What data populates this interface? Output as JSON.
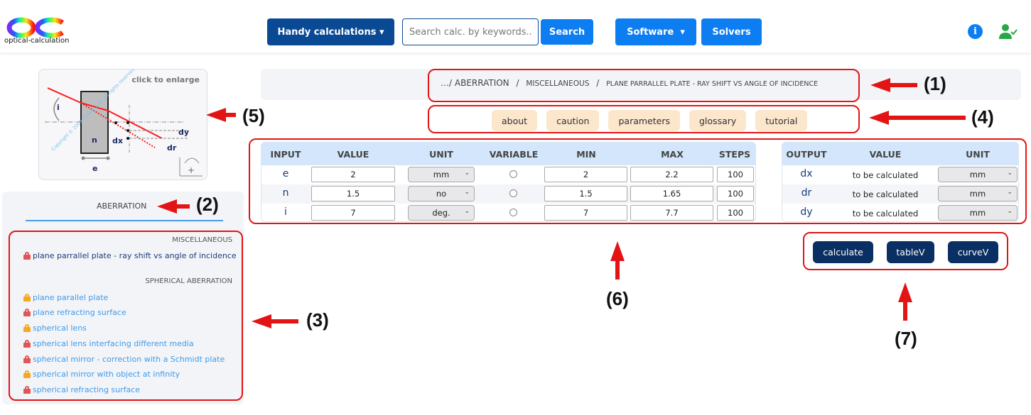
{
  "navbar": {
    "logo_text": "optical-calculation",
    "handy_label": "Handy calculations ▾",
    "search_placeholder": "Search calc. by keywords...",
    "search_label": "Search",
    "software_label": "Software  ▾",
    "solvers_label": "Solvers",
    "info_glyph": "i"
  },
  "thumbnail": {
    "label": "click to enlarge",
    "diagram": {
      "angle_label": "i",
      "index_label": "n",
      "thickness_label": "e",
      "dx_label": "dx",
      "dy_label": "dy",
      "dr_label": "dr",
      "watermark": "Copyright © 2009 CLAVIS SAS. All rights reserved"
    }
  },
  "sidebar": {
    "title": "ABERRATION",
    "categories": [
      {
        "name": "MISCELLANEOUS",
        "items": [
          {
            "label": "plane parrallel plate - ray shift vs angle of incidence",
            "lock": "red",
            "active": true
          }
        ]
      },
      {
        "name": "SPHERICAL ABERRATION",
        "items": [
          {
            "label": "plane parallel plate",
            "lock": "orange"
          },
          {
            "label": "plane refracting surface",
            "lock": "red"
          },
          {
            "label": "spherical lens",
            "lock": "orange"
          },
          {
            "label": "spherical lens interfacing different media",
            "lock": "red"
          },
          {
            "label": "spherical mirror - correction with a Schmidt plate",
            "lock": "red"
          },
          {
            "label": "spherical mirror with object at infinity",
            "lock": "orange"
          },
          {
            "label": "spherical refracting surface",
            "lock": "red"
          }
        ]
      }
    ]
  },
  "breadcrumb": {
    "prefix": "…/",
    "level1": "ABERRATION",
    "level2": "MISCELLANEOUS",
    "level3": "PLANE PARRALLEL PLATE - RAY SHIFT VS ANGLE OF INCIDENCE",
    "separator": "/"
  },
  "tabs": [
    "about",
    "caution",
    "parameters",
    "glossary",
    "tutorial"
  ],
  "input_table": {
    "headers": [
      "INPUT",
      "VALUE",
      "UNIT",
      "VARIABLE",
      "MIN",
      "MAX",
      "STEPS"
    ],
    "rows": [
      {
        "name": "e",
        "value": "2",
        "unit": "mm",
        "variable": false,
        "min": "2",
        "max": "2.2",
        "steps": "100"
      },
      {
        "name": "n",
        "value": "1.5",
        "unit": "no",
        "variable": false,
        "min": "1.5",
        "max": "1.65",
        "steps": "100"
      },
      {
        "name": "i",
        "value": "7",
        "unit": "deg.",
        "variable": false,
        "min": "7",
        "max": "7.7",
        "steps": "100"
      }
    ]
  },
  "output_table": {
    "headers": [
      "OUTPUT",
      "VALUE",
      "UNIT"
    ],
    "rows": [
      {
        "name": "dx",
        "value": "to be calculated",
        "unit": "mm"
      },
      {
        "name": "dr",
        "value": "to be calculated",
        "unit": "mm"
      },
      {
        "name": "dy",
        "value": "to be calculated",
        "unit": "mm"
      }
    ]
  },
  "actions": {
    "calculate": "calculate",
    "tableV": "tableV",
    "curveV": "curveV"
  },
  "chevron": "⌄",
  "annotations": {
    "color": "#e31414",
    "labels": [
      "(1)",
      "(2)",
      "(3)",
      "(4)",
      "(5)",
      "(6)",
      "(7)"
    ]
  }
}
